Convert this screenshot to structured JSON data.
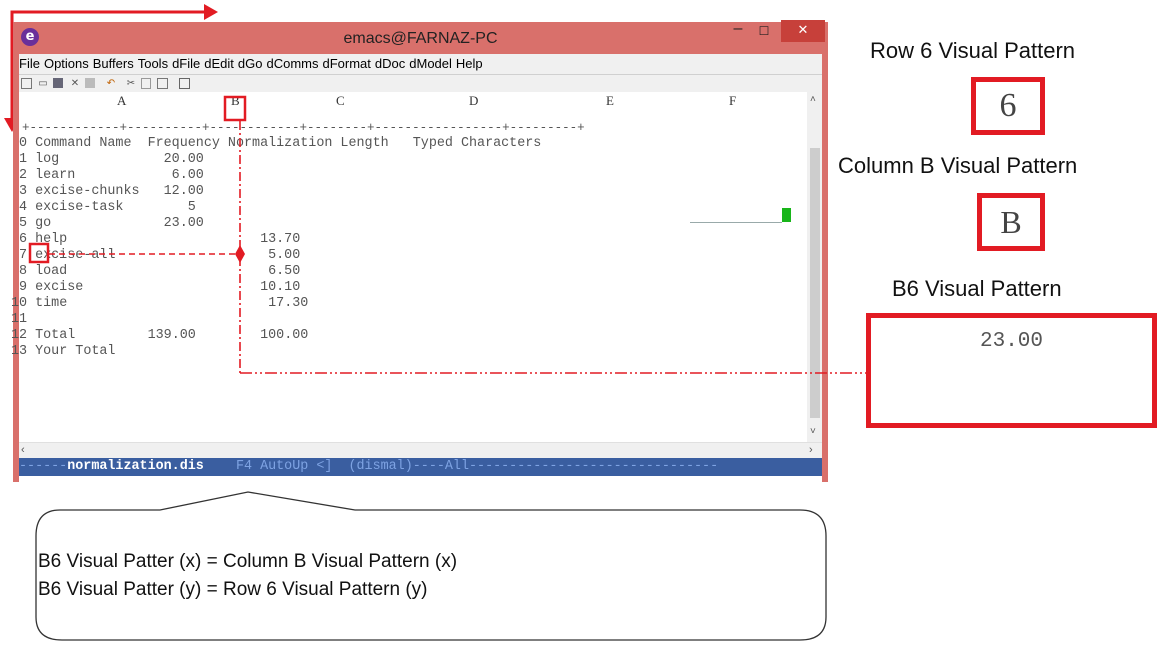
{
  "window": {
    "title": "emacs@FARNAZ-PC",
    "app_icon": "emacs-icon",
    "controls": {
      "minimize": "–",
      "maximize": "☐",
      "close": "✕"
    }
  },
  "menu": [
    "File",
    "Options",
    "Buffers",
    "Tools",
    "dFile",
    "dEdit",
    "dGo",
    "dComms",
    "dFormat",
    "dDoc",
    "dModel",
    "Help"
  ],
  "toolbar_icons": [
    "new-file-icon",
    "open-folder-icon",
    "save-icon",
    "close-icon",
    "save-disk-icon",
    "undo-icon",
    "cut-icon",
    "copy-icon",
    "paste-icon",
    "search-icon"
  ],
  "spreadsheet": {
    "columns": [
      "A",
      "B",
      "C",
      "D",
      "E",
      "F"
    ],
    "separator": "+------------+----------+------------+--------+-----------------+---------+",
    "header_row": "0 Command Name  Frequency Normalization Length   Typed Characters",
    "rows": [
      "1 log             20.00",
      "2 learn            6.00",
      "3 excise-chunks   12.00",
      "4 excise-task        5",
      "5 go              23.00",
      "6 help                        13.70",
      "7 excise-all                   5.00",
      "8 load                         6.50",
      "9 excise                      10.10",
      "10 time                         17.30",
      "11",
      "12 Total         139.00        100.00",
      "13 Your Total"
    ]
  },
  "modeline": {
    "prefix": "------",
    "buffer": "normalization.dis",
    "rest": "    F4 AutoUp <]  (dismal)----All-------------------------------"
  },
  "annotations": {
    "row6_title": "Row 6 Visual Pattern",
    "row6_value": "6",
    "colB_title": "Column B Visual Pattern",
    "colB_value": "B",
    "b6_title": "B6 Visual Pattern",
    "b6_value": "23.00",
    "callout_line1": "B6 Visual Patter (x) = Column B Visual Pattern (x)",
    "callout_line2": "B6 Visual Patter (y) = Row 6 Visual Pattern (y)",
    "accent_color": "#e21b23"
  }
}
